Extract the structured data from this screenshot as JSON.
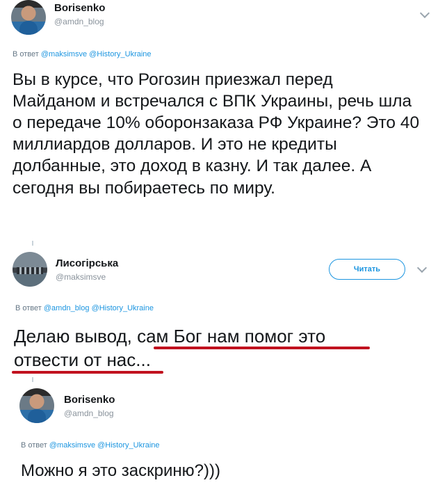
{
  "tweets": [
    {
      "name": "Borisenko",
      "handle": "@amdn_blog",
      "reply_prefix": "В ответ",
      "reply_to_1": "@maksimsve",
      "reply_to_2": "@History_Ukraine",
      "text": "Вы в курсе, что Рогозин приезжал перед Майданом и встречался с ВПК Украины, речь шла о передаче 10% оборонзаказа РФ Украине? Это 40 миллиардов долларов. И это не кредиты долбанные, это доход в казну. И так далее. А сегодня вы побираетесь по миру."
    },
    {
      "name": "Лисогірська",
      "handle": "@maksimsve",
      "follow_label": "Читать",
      "reply_prefix": "В ответ",
      "reply_to_1": "@amdn_blog",
      "reply_to_2": "@History_Ukraine",
      "text_part1": "Делаю вывод, ",
      "text_part2": "сам Бог нам помог это",
      "text_part3": "отвести от нас..."
    },
    {
      "name": "Borisenko",
      "handle": "@amdn_blog",
      "reply_prefix": "В ответ",
      "reply_to_1": "@maksimsve",
      "reply_to_2": "@History_Ukraine",
      "text": "Можно я это заскриню?)))"
    }
  ],
  "colors": {
    "link": "#1b95e0",
    "underline": "#c1121f"
  },
  "icons": [
    "chevron-down-icon"
  ]
}
